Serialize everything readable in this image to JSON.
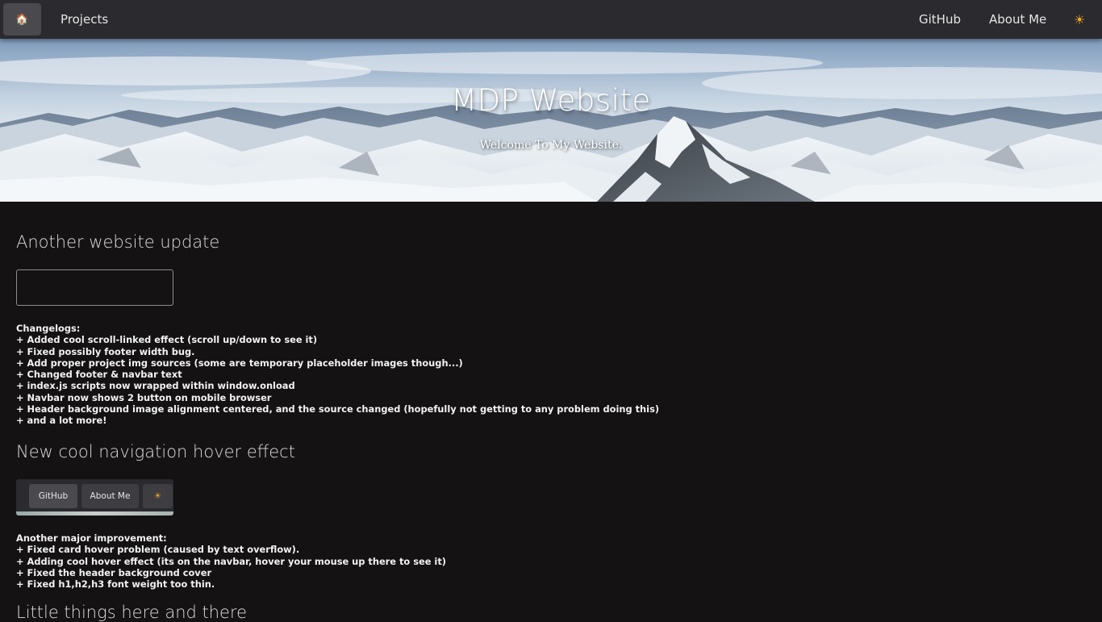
{
  "navbar": {
    "home_icon": "🏠",
    "projects_label": "Projects",
    "github_label": "GitHub",
    "about_label": "About Me",
    "theme_icon": "☀"
  },
  "hero": {
    "title": "MDP Website",
    "subtitle": "Welcome To My Website."
  },
  "sections": [
    {
      "title": "Another website update",
      "changelog": [
        "Changelogs:",
        "+ Added cool scroll-linked effect (scroll up/down to see it)",
        "+ Fixed possibly footer width bug.",
        "+ Add proper project img sources (some are temporary placeholder images though...)",
        "+ Changed footer & navbar text",
        "+ index.js scripts now wrapped within window.onload",
        "+ Navbar now shows 2 button on mobile browser",
        "+ Header background image alignment centered, and the source changed (hopefully not getting to any problem doing this)",
        "+ and a lot more!"
      ]
    },
    {
      "title": "New cool navigation hover effect",
      "preview": {
        "github_label": "GitHub",
        "about_label": "About Me",
        "theme_icon": "☀"
      },
      "changelog": [
        "Another major improvement:",
        "+ Fixed card hover problem (caused by text overflow).",
        "+ Adding cool hover effect (its on the navbar, hover your mouse up there to see it)",
        "+ Fixed the header background cover",
        "+ Fixed h1,h2,h3 font weight too thin."
      ]
    },
    {
      "title": "Little things here and there"
    }
  ],
  "colors": {
    "background": "#141213",
    "navbar": "#2b2a2e",
    "accent_sun": "#f5a623"
  }
}
